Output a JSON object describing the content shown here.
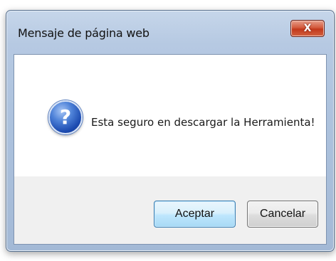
{
  "dialog": {
    "title": "Mensaje de página web",
    "close_label": "X",
    "icon": "question-icon",
    "icon_glyph": "?",
    "message": "Esta seguro en descargar la Herramienta!",
    "buttons": {
      "accept_label": "Aceptar",
      "cancel_label": "Cancelar"
    }
  },
  "colors": {
    "frame": "#aec3de",
    "close_button": "#c2391c",
    "default_button": "#bee6fd",
    "icon_blue": "#1c4bb0"
  }
}
